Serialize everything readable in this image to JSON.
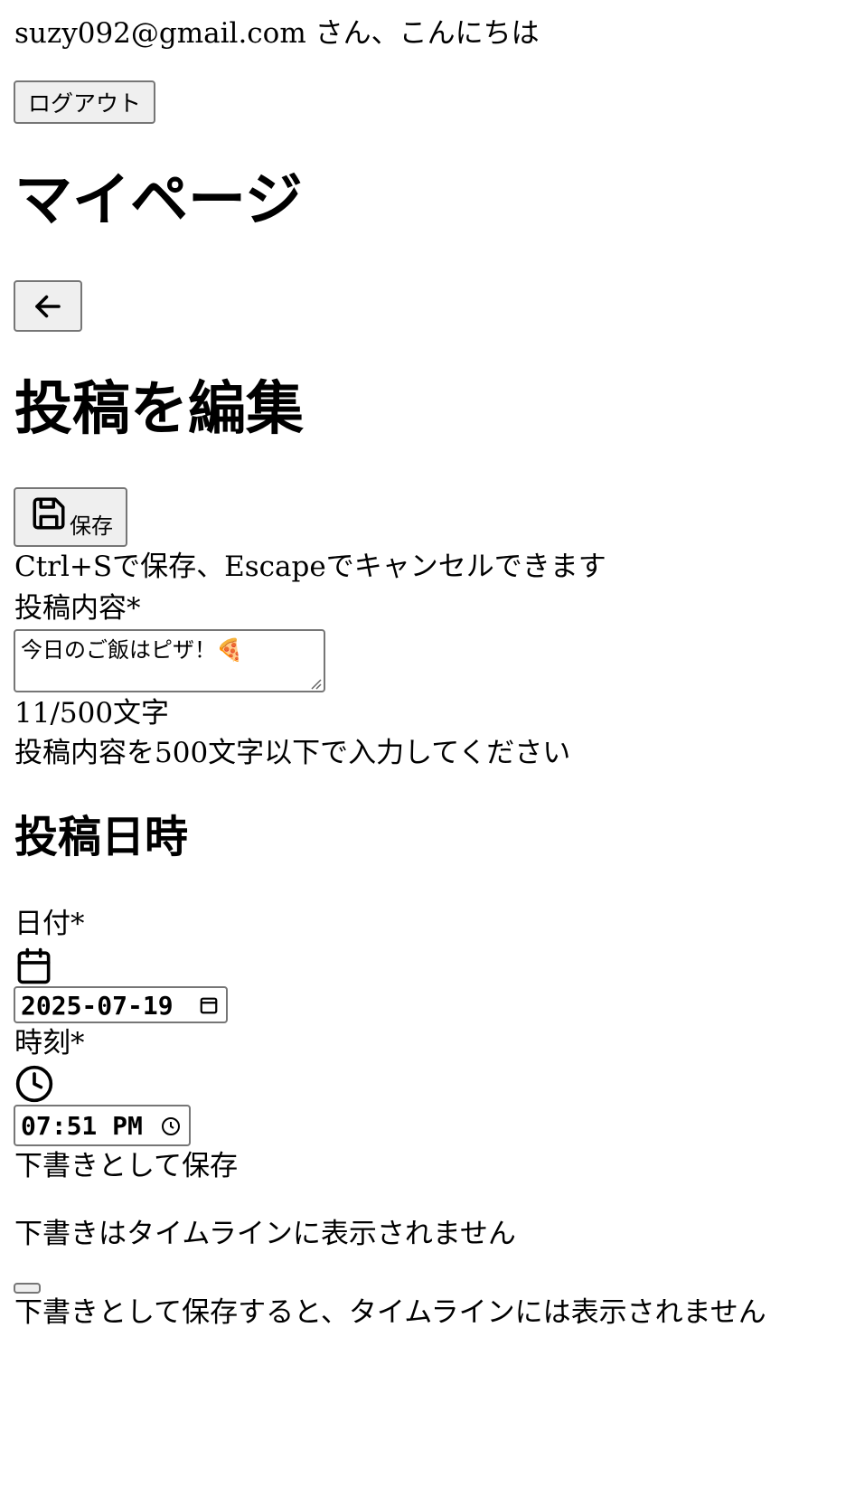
{
  "greeting": {
    "email": "suzy092@gmail.com",
    "suffix": "さん、こんにちは"
  },
  "logout_label": "ログアウト",
  "page_title": "マイページ",
  "back_icon": "arrow-left-icon",
  "edit_title": "投稿を編集",
  "save": {
    "icon": "floppy-disk-icon",
    "label": "保存"
  },
  "shortcut_hint": "Ctrl+Sで保存、Escapeでキャンセルできます",
  "content": {
    "label": "投稿内容",
    "required_mark": "*",
    "value": "今日のご飯はピザ！🍕",
    "char_count": "11/500文字",
    "hint": "投稿内容を500文字以下で入力してください"
  },
  "datetime": {
    "heading": "投稿日時",
    "date_label": "日付",
    "date_required": "*",
    "date_icon": "calendar-icon",
    "date_value": "2025-07-19",
    "time_label": "時刻",
    "time_required": "*",
    "time_icon": "clock-icon",
    "time_value": "07:51 PM"
  },
  "draft": {
    "label": "下書きとして保存",
    "description": "下書きはタイムラインに表示されません",
    "toggle_on": false,
    "note": "下書きとして保存すると、タイムラインには表示されません"
  },
  "colors": {
    "button_bg": "#efefef",
    "border": "#767676",
    "text": "#000000"
  }
}
